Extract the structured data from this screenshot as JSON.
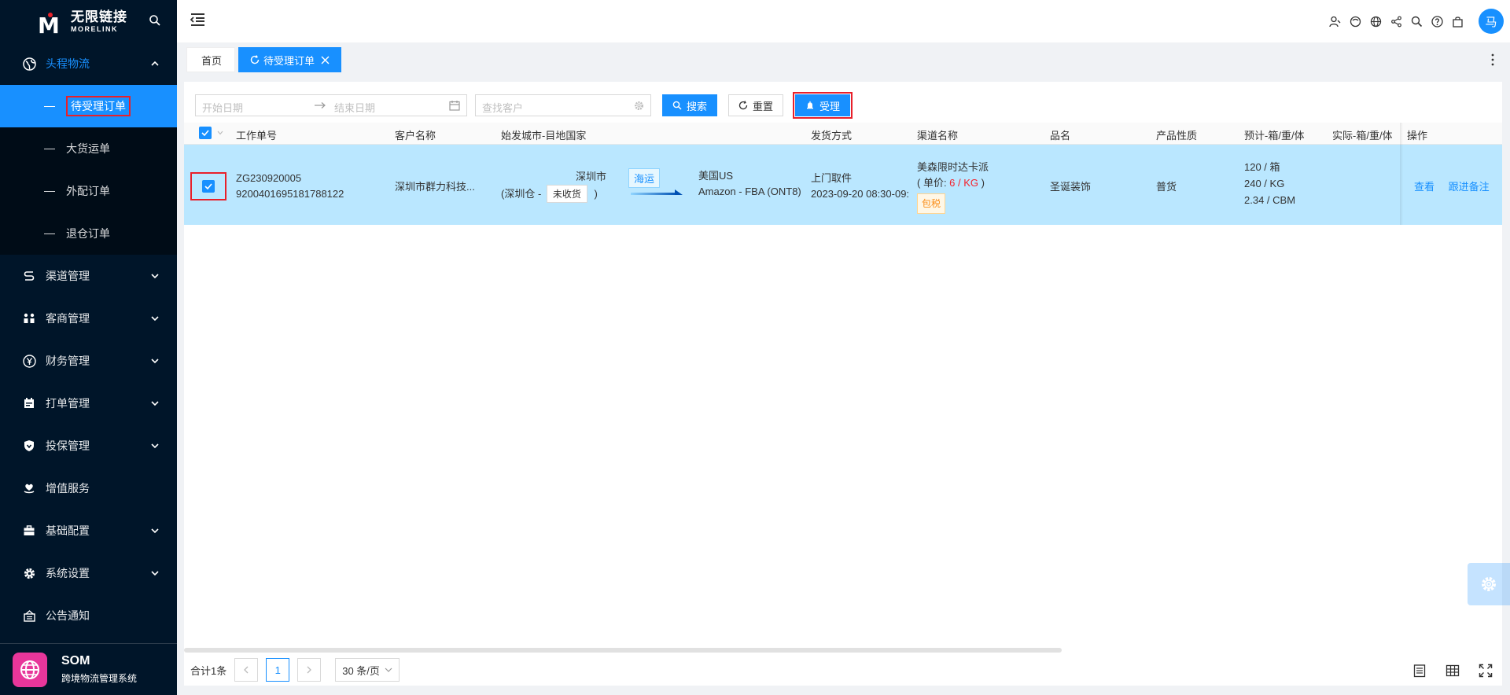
{
  "logo": {
    "cn": "无限链接",
    "en": "MORELINK"
  },
  "sidebar": {
    "menus": [
      {
        "label": "头程物流",
        "icon": "globe-icon",
        "expanded": true,
        "children": [
          {
            "label": "待受理订单",
            "selected": true
          },
          {
            "label": "大货运单"
          },
          {
            "label": "外配订单"
          },
          {
            "label": "退仓订单"
          }
        ]
      },
      {
        "label": "渠道管理",
        "icon": "channel-icon"
      },
      {
        "label": "客商管理",
        "icon": "merchant-icon"
      },
      {
        "label": "财务管理",
        "icon": "yen-icon"
      },
      {
        "label": "打单管理",
        "icon": "print-order-icon"
      },
      {
        "label": "投保管理",
        "icon": "shield-icon"
      },
      {
        "label": "增值服务",
        "icon": "heart-hand-icon"
      },
      {
        "label": "基础配置",
        "icon": "briefcase-icon"
      },
      {
        "label": "系统设置",
        "icon": "gear-icon"
      },
      {
        "label": "公告通知",
        "icon": "notice-icon"
      }
    ]
  },
  "brand": {
    "name": "SOM",
    "subtitle": "跨境物流管理系统"
  },
  "header": {
    "avatar": "马"
  },
  "tabs": [
    {
      "label": "首页",
      "active": false
    },
    {
      "label": "待受理订单",
      "active": true
    }
  ],
  "toolbar": {
    "start_placeholder": "开始日期",
    "end_placeholder": "结束日期",
    "customer_placeholder": "查找客户",
    "search_label": "搜索",
    "reset_label": "重置",
    "accept_label": "受理"
  },
  "table": {
    "columns": [
      "工作单号",
      "客户名称",
      "始发城市-目地国家",
      "发货方式",
      "渠道名称",
      "品名",
      "产品性质",
      "预计-箱/重/体",
      "实际-箱/重/体",
      "操作"
    ],
    "rows": [
      {
        "checked": true,
        "work_no": "ZG230920005",
        "work_no2": "9200401695181788122",
        "customer": "深圳市群力科技...",
        "origin_city": "深圳市",
        "origin_wh_prefix": "(深圳仓 -",
        "origin_status": "未收货",
        "origin_wh_suffix": ")",
        "mode": "海运",
        "dest_country": "美国US",
        "dest_wh": "Amazon - FBA (ONT8)",
        "ship_method": "上门取件",
        "ship_time": "2023-09-20 08:30-09:",
        "channel_name": "美森限时达卡派",
        "price_prefix": "( 单价: ",
        "price_value": "6 / KG",
        "price_suffix": " )",
        "tax_tag": "包税",
        "product": "圣诞装饰",
        "nature": "普货",
        "est_boxes": "120 / 箱",
        "est_weight": "240 / KG",
        "est_volume": "2.34 / CBM",
        "actions": {
          "view": "查看",
          "follow": "跟进备注"
        }
      }
    ]
  },
  "footer": {
    "total": "合计1条",
    "current_page": "1",
    "page_size": "30 条/页"
  },
  "colors": {
    "primary": "#1890ff",
    "sidebar_bg": "#001529",
    "row_selected": "#bae7ff",
    "highlight_red": "#e8202a"
  }
}
